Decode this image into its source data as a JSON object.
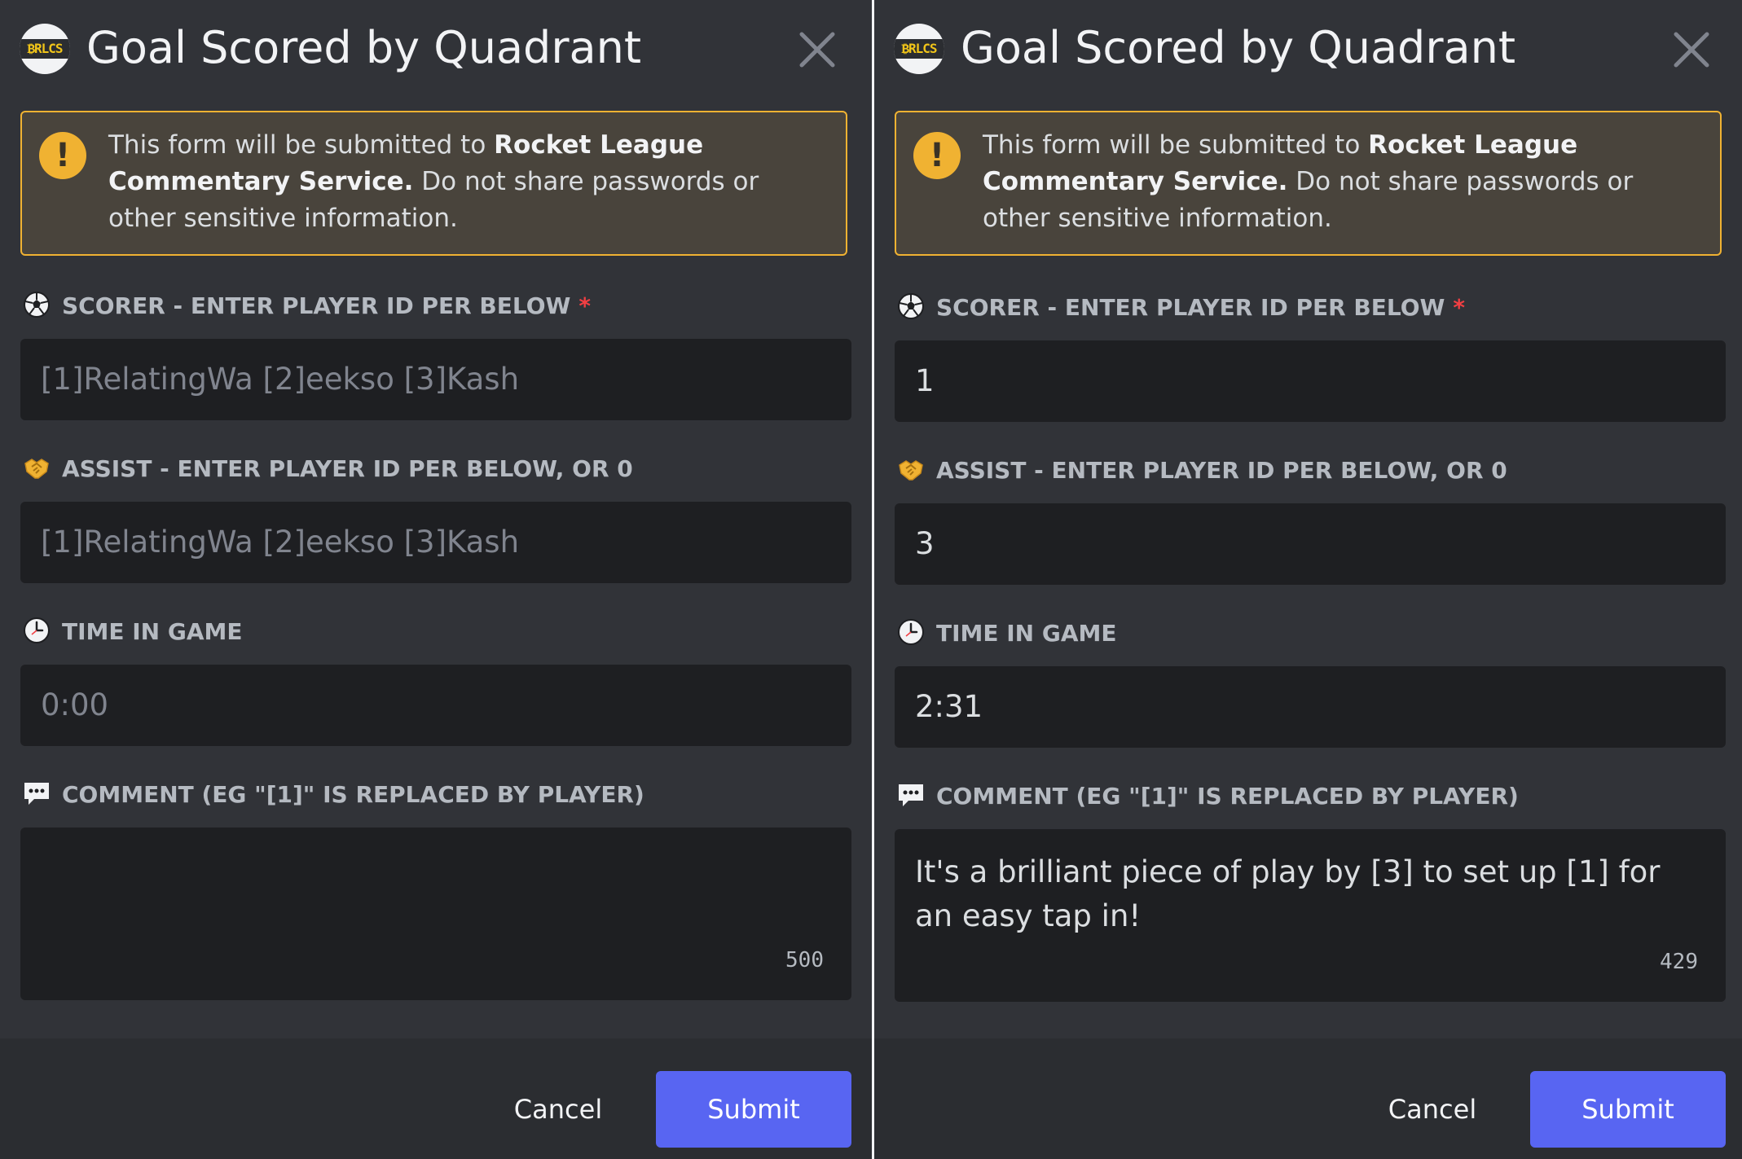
{
  "colors": {
    "accent": "#5865f2",
    "warning": "#f0b232",
    "required": "#f23f43",
    "background": "#313338",
    "input": "#1e1f22"
  },
  "panels": [
    {
      "logo_text": "₿RLCS",
      "title": "Goal Scored by Quadrant",
      "notice": {
        "pre": "This form will be submitted to ",
        "bold": "Rocket League Commentary Service.",
        "post": " Do not share passwords or other sensitive information."
      },
      "fields": [
        {
          "icon": "soccer-ball-icon",
          "label": "SCORER - ENTER PLAYER ID PER BELOW",
          "required_mark": "*",
          "value": "",
          "placeholder": "[1]RelatingWa [2]eekso [3]Kash"
        },
        {
          "icon": "handshake-icon",
          "label": "ASSIST - ENTER PLAYER ID PER BELOW, OR 0",
          "value": "",
          "placeholder": "[1]RelatingWa [2]eekso [3]Kash"
        },
        {
          "icon": "clock-icon",
          "label": "TIME IN GAME",
          "value": "",
          "placeholder": "0:00"
        },
        {
          "icon": "speech-bubble-icon",
          "label": "COMMENT (EG \"[1]\" IS REPLACED BY PLAYER)",
          "value": "",
          "counter": "500"
        }
      ],
      "cancel_label": "Cancel",
      "submit_label": "Submit"
    },
    {
      "logo_text": "₿RLCS",
      "title": "Goal Scored by Quadrant",
      "notice": {
        "pre": "This form will be submitted to ",
        "bold": "Rocket League Commentary Service.",
        "post": " Do not share passwords or other sensitive information."
      },
      "fields": [
        {
          "icon": "soccer-ball-icon",
          "label": "SCORER - ENTER PLAYER ID PER BELOW",
          "required_mark": "*",
          "value": "1",
          "placeholder": ""
        },
        {
          "icon": "handshake-icon",
          "label": "ASSIST - ENTER PLAYER ID PER BELOW, OR 0",
          "value": "3",
          "placeholder": ""
        },
        {
          "icon": "clock-icon",
          "label": "TIME IN GAME",
          "value": "2:31",
          "placeholder": ""
        },
        {
          "icon": "speech-bubble-icon",
          "label": "COMMENT (EG \"[1]\" IS REPLACED BY PLAYER)",
          "value": "It's a brilliant piece of play by [3] to set up [1] for an easy tap in!",
          "counter": "429"
        }
      ],
      "cancel_label": "Cancel",
      "submit_label": "Submit"
    }
  ]
}
